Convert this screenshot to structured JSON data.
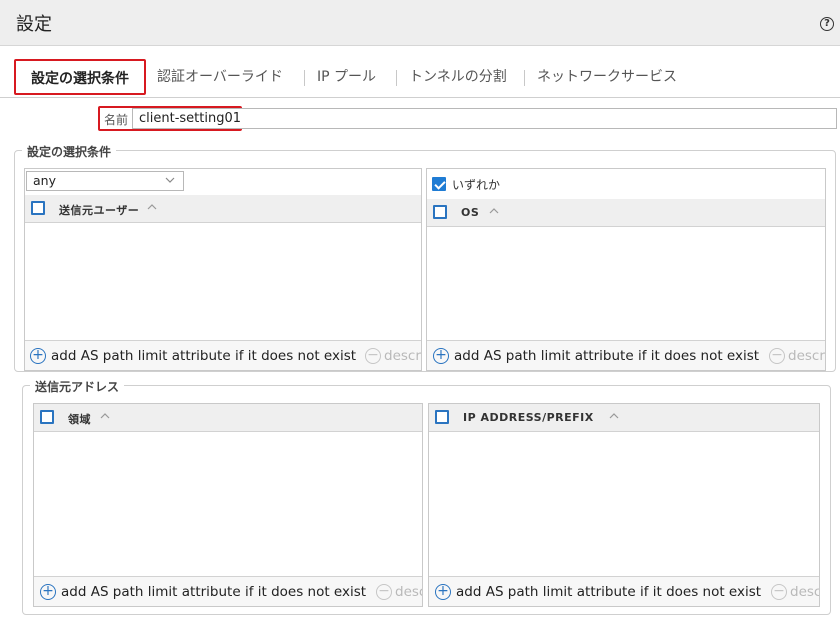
{
  "window": {
    "title": "設定",
    "help_icon": "question-circle-icon",
    "help_glyph": "?"
  },
  "tabs": [
    {
      "label": "設定の選択条件",
      "active": true
    },
    {
      "label": "認証オーバーライド"
    },
    {
      "label": "IP プール"
    },
    {
      "label": "トンネルの分割"
    },
    {
      "label": "ネットワークサービス"
    }
  ],
  "name": {
    "label": "名前",
    "value": "client-setting01"
  },
  "selection": {
    "legend": "設定の選択条件",
    "user_filter": {
      "value": "any"
    },
    "os_any": {
      "label": "いずれか",
      "checked": true
    },
    "users_grid": {
      "column": "送信元ユーザー"
    },
    "os_grid": {
      "column": "OS"
    }
  },
  "source_address": {
    "legend": "送信元アドレス",
    "region_grid": {
      "column": "領域"
    },
    "ip_grid": {
      "column": "IP ADDRESS/PREFIX"
    }
  },
  "footer": {
    "add_label": "add AS path limit attribute if it does not exist",
    "delete_label_visible": "descr",
    "delete_label_visible_short": "desc",
    "add_glyph": "+",
    "delete_glyph": "−"
  },
  "colors": {
    "accent": "#2a74c0",
    "highlight": "#d71920",
    "header_bg": "#eeeeee"
  }
}
